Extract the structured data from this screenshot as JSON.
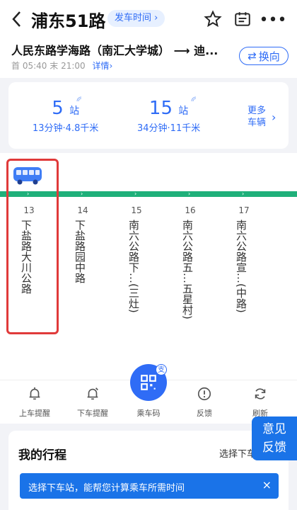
{
  "header": {
    "title": "浦东51路",
    "depart_time": "发车时间",
    "route": "人民东路学海路（南汇大学城）",
    "route_end": "迪...",
    "first_label": "首",
    "first_time": "05:40",
    "last_label": "末",
    "last_time": "21:00",
    "details": "详情",
    "reverse": "换向"
  },
  "buses": [
    {
      "stations": "5",
      "unit": "站",
      "sub": "13分钟·4.8千米"
    },
    {
      "stations": "15",
      "unit": "站",
      "sub": "34分钟·11千米"
    }
  ],
  "more_vehicles": {
    "line1": "更多",
    "line2": "车辆"
  },
  "stops": [
    {
      "num": "13",
      "name": "下盐路大川公路"
    },
    {
      "num": "14",
      "name": "下盐路园中路"
    },
    {
      "num": "15",
      "name": "南六公路下…(三灶)"
    },
    {
      "num": "16",
      "name": "南六公路五…五星村)"
    },
    {
      "num": "17",
      "name": "南六公路宣…(中路)"
    }
  ],
  "actions": {
    "board_reminder": "上车提醒",
    "alight_reminder": "下车提醒",
    "ride_code": "乘车码",
    "feedback": "反馈",
    "refresh": "刷新",
    "ride_badge": "支"
  },
  "trip": {
    "title": "我的行程",
    "select_stop": "选择下车站",
    "banner": "选择下车站，能帮您计算乘车所需时间",
    "close": "×"
  },
  "feedback_float": {
    "line1": "意见",
    "line2": "反馈"
  },
  "colors": {
    "accent": "#2f6cf6",
    "track": "#1fb07a",
    "highlight": "#e03a3a"
  }
}
